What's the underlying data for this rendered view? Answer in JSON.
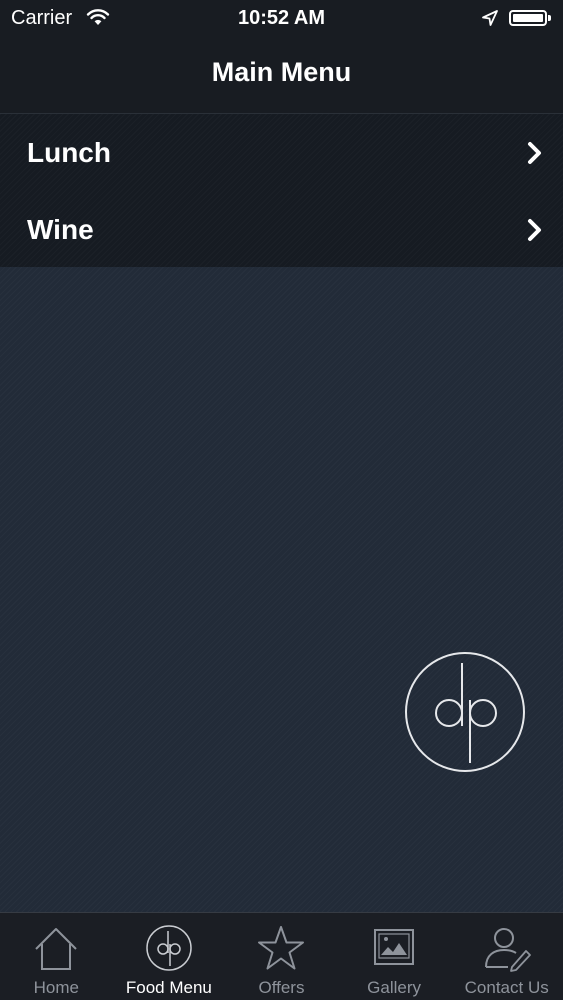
{
  "status_bar": {
    "carrier": "Carrier",
    "time": "10:52 AM",
    "icons": [
      "wifi-icon",
      "location-arrow-icon",
      "battery-icon"
    ]
  },
  "nav": {
    "title": "Main Menu"
  },
  "menu": {
    "items": [
      {
        "label": "Lunch",
        "icon": "chevron-right-icon"
      },
      {
        "label": "Wine",
        "icon": "chevron-right-icon"
      }
    ]
  },
  "logo": {
    "text": "dp"
  },
  "tabbar": {
    "active_index": 1,
    "tabs": [
      {
        "label": "Home",
        "icon": "home-icon"
      },
      {
        "label": "Food Menu",
        "icon": "dp-logo-icon"
      },
      {
        "label": "Offers",
        "icon": "star-icon"
      },
      {
        "label": "Gallery",
        "icon": "picture-icon"
      },
      {
        "label": "Contact Us",
        "icon": "contact-person-icon"
      }
    ]
  },
  "colors": {
    "background": "#222b38",
    "bar": "#181c22",
    "text": "#ffffff",
    "tab_inactive": "#8e939b"
  }
}
